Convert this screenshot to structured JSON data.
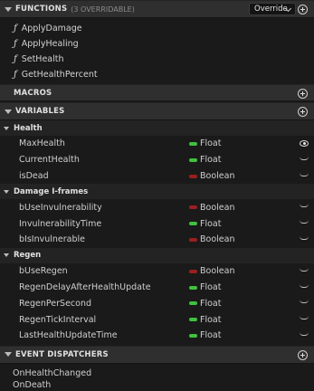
{
  "functions": {
    "title": "FUNCTIONS",
    "overridable": "(3 OVERRIDABLE)",
    "override_label": "Override",
    "items": [
      "ApplyDamage",
      "ApplyHealing",
      "SetHealth",
      "GetHealthPercent"
    ]
  },
  "macros": {
    "title": "MACROS"
  },
  "variables": {
    "title": "VARIABLES",
    "categories": [
      {
        "name": "Health",
        "items": [
          {
            "name": "MaxHealth",
            "type": "Float",
            "color": "#3fc23f",
            "eye": "open"
          },
          {
            "name": "CurrentHealth",
            "type": "Float",
            "color": "#3fc23f",
            "eye": "closed"
          },
          {
            "name": "isDead",
            "type": "Boolean",
            "color": "#9b1f1f",
            "eye": "closed"
          }
        ]
      },
      {
        "name": "Damage I-frames",
        "items": [
          {
            "name": "bUseInvulnerability",
            "type": "Boolean",
            "color": "#9b1f1f",
            "eye": "closed"
          },
          {
            "name": "InvulnerabilityTime",
            "type": "Float",
            "color": "#3fc23f",
            "eye": "closed"
          },
          {
            "name": "bIsInvulnerable",
            "type": "Boolean",
            "color": "#9b1f1f",
            "eye": "closed"
          }
        ]
      },
      {
        "name": "Regen",
        "items": [
          {
            "name": "bUseRegen",
            "type": "Boolean",
            "color": "#9b1f1f",
            "eye": "closed"
          },
          {
            "name": "RegenDelayAfterHealthUpdate",
            "type": "Float",
            "color": "#3fc23f",
            "eye": "closed"
          },
          {
            "name": "RegenPerSecond",
            "type": "Float",
            "color": "#3fc23f",
            "eye": "closed"
          },
          {
            "name": "RegenTickInterval",
            "type": "Float",
            "color": "#3fc23f",
            "eye": "closed"
          },
          {
            "name": "LastHealthUpdateTime",
            "type": "Float",
            "color": "#3fc23f",
            "eye": "closed"
          }
        ]
      }
    ]
  },
  "dispatchers": {
    "title": "EVENT DISPATCHERS",
    "items": [
      "OnHealthChanged",
      "OnDeath"
    ]
  }
}
